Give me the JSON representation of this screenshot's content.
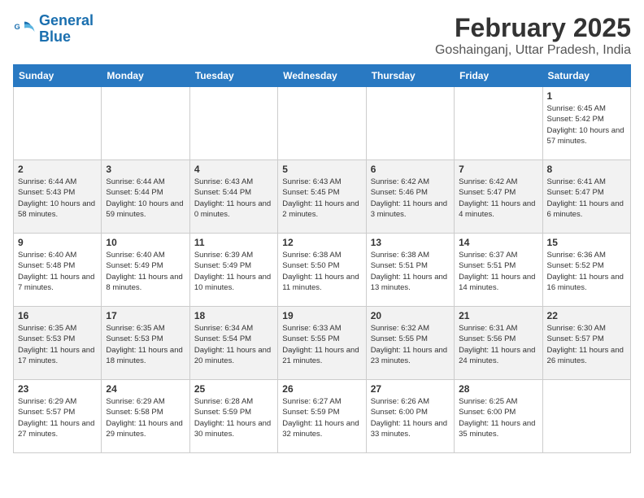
{
  "logo": {
    "text_general": "General",
    "text_blue": "Blue"
  },
  "title": "February 2025",
  "subtitle": "Goshainganj, Uttar Pradesh, India",
  "weekdays": [
    "Sunday",
    "Monday",
    "Tuesday",
    "Wednesday",
    "Thursday",
    "Friday",
    "Saturday"
  ],
  "weeks": [
    [
      {
        "day": "",
        "info": ""
      },
      {
        "day": "",
        "info": ""
      },
      {
        "day": "",
        "info": ""
      },
      {
        "day": "",
        "info": ""
      },
      {
        "day": "",
        "info": ""
      },
      {
        "day": "",
        "info": ""
      },
      {
        "day": "1",
        "info": "Sunrise: 6:45 AM\nSunset: 5:42 PM\nDaylight: 10 hours and 57 minutes."
      }
    ],
    [
      {
        "day": "2",
        "info": "Sunrise: 6:44 AM\nSunset: 5:43 PM\nDaylight: 10 hours and 58 minutes."
      },
      {
        "day": "3",
        "info": "Sunrise: 6:44 AM\nSunset: 5:44 PM\nDaylight: 10 hours and 59 minutes."
      },
      {
        "day": "4",
        "info": "Sunrise: 6:43 AM\nSunset: 5:44 PM\nDaylight: 11 hours and 0 minutes."
      },
      {
        "day": "5",
        "info": "Sunrise: 6:43 AM\nSunset: 5:45 PM\nDaylight: 11 hours and 2 minutes."
      },
      {
        "day": "6",
        "info": "Sunrise: 6:42 AM\nSunset: 5:46 PM\nDaylight: 11 hours and 3 minutes."
      },
      {
        "day": "7",
        "info": "Sunrise: 6:42 AM\nSunset: 5:47 PM\nDaylight: 11 hours and 4 minutes."
      },
      {
        "day": "8",
        "info": "Sunrise: 6:41 AM\nSunset: 5:47 PM\nDaylight: 11 hours and 6 minutes."
      }
    ],
    [
      {
        "day": "9",
        "info": "Sunrise: 6:40 AM\nSunset: 5:48 PM\nDaylight: 11 hours and 7 minutes."
      },
      {
        "day": "10",
        "info": "Sunrise: 6:40 AM\nSunset: 5:49 PM\nDaylight: 11 hours and 8 minutes."
      },
      {
        "day": "11",
        "info": "Sunrise: 6:39 AM\nSunset: 5:49 PM\nDaylight: 11 hours and 10 minutes."
      },
      {
        "day": "12",
        "info": "Sunrise: 6:38 AM\nSunset: 5:50 PM\nDaylight: 11 hours and 11 minutes."
      },
      {
        "day": "13",
        "info": "Sunrise: 6:38 AM\nSunset: 5:51 PM\nDaylight: 11 hours and 13 minutes."
      },
      {
        "day": "14",
        "info": "Sunrise: 6:37 AM\nSunset: 5:51 PM\nDaylight: 11 hours and 14 minutes."
      },
      {
        "day": "15",
        "info": "Sunrise: 6:36 AM\nSunset: 5:52 PM\nDaylight: 11 hours and 16 minutes."
      }
    ],
    [
      {
        "day": "16",
        "info": "Sunrise: 6:35 AM\nSunset: 5:53 PM\nDaylight: 11 hours and 17 minutes."
      },
      {
        "day": "17",
        "info": "Sunrise: 6:35 AM\nSunset: 5:53 PM\nDaylight: 11 hours and 18 minutes."
      },
      {
        "day": "18",
        "info": "Sunrise: 6:34 AM\nSunset: 5:54 PM\nDaylight: 11 hours and 20 minutes."
      },
      {
        "day": "19",
        "info": "Sunrise: 6:33 AM\nSunset: 5:55 PM\nDaylight: 11 hours and 21 minutes."
      },
      {
        "day": "20",
        "info": "Sunrise: 6:32 AM\nSunset: 5:55 PM\nDaylight: 11 hours and 23 minutes."
      },
      {
        "day": "21",
        "info": "Sunrise: 6:31 AM\nSunset: 5:56 PM\nDaylight: 11 hours and 24 minutes."
      },
      {
        "day": "22",
        "info": "Sunrise: 6:30 AM\nSunset: 5:57 PM\nDaylight: 11 hours and 26 minutes."
      }
    ],
    [
      {
        "day": "23",
        "info": "Sunrise: 6:29 AM\nSunset: 5:57 PM\nDaylight: 11 hours and 27 minutes."
      },
      {
        "day": "24",
        "info": "Sunrise: 6:29 AM\nSunset: 5:58 PM\nDaylight: 11 hours and 29 minutes."
      },
      {
        "day": "25",
        "info": "Sunrise: 6:28 AM\nSunset: 5:59 PM\nDaylight: 11 hours and 30 minutes."
      },
      {
        "day": "26",
        "info": "Sunrise: 6:27 AM\nSunset: 5:59 PM\nDaylight: 11 hours and 32 minutes."
      },
      {
        "day": "27",
        "info": "Sunrise: 6:26 AM\nSunset: 6:00 PM\nDaylight: 11 hours and 33 minutes."
      },
      {
        "day": "28",
        "info": "Sunrise: 6:25 AM\nSunset: 6:00 PM\nDaylight: 11 hours and 35 minutes."
      },
      {
        "day": "",
        "info": ""
      }
    ]
  ]
}
